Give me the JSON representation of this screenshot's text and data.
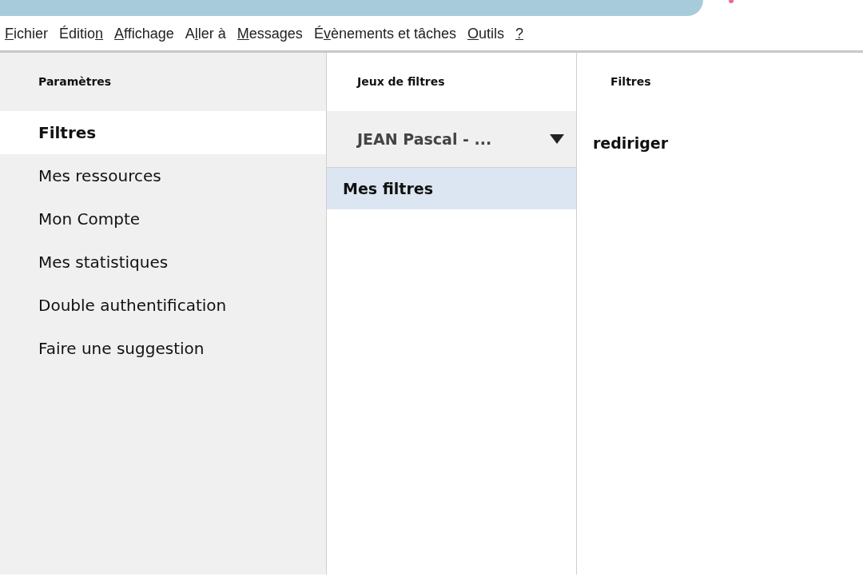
{
  "menu_bar": [
    {
      "access_key": "F",
      "after": "ichier"
    },
    {
      "before": "Éditio",
      "access_key": "n"
    },
    {
      "access_key": "A",
      "after": "ffichage"
    },
    {
      "before": "A",
      "access_key": "l",
      "after": "ler à"
    },
    {
      "access_key": "M",
      "after": "essages"
    },
    {
      "before": "É",
      "access_key": "v",
      "after": "ènements et tâches"
    },
    {
      "access_key": "O",
      "after": "utils"
    },
    {
      "access_key": "?"
    }
  ],
  "settings": {
    "header": "Paramètres",
    "items": [
      {
        "label": "Filtres",
        "selected": true
      },
      {
        "label": "Mes ressources",
        "selected": false
      },
      {
        "label": "Mon Compte",
        "selected": false
      },
      {
        "label": "Mes statistiques",
        "selected": false
      },
      {
        "label": "Double authentification",
        "selected": false
      },
      {
        "label": "Faire une suggestion",
        "selected": false
      }
    ]
  },
  "filter_sets": {
    "header": "Jeux de filtres",
    "account": "JEAN Pascal - ...",
    "items": [
      {
        "label": "Mes filtres",
        "selected": true
      }
    ]
  },
  "filters": {
    "header": "Filtres",
    "items": [
      {
        "label": "rediriger"
      }
    ]
  }
}
